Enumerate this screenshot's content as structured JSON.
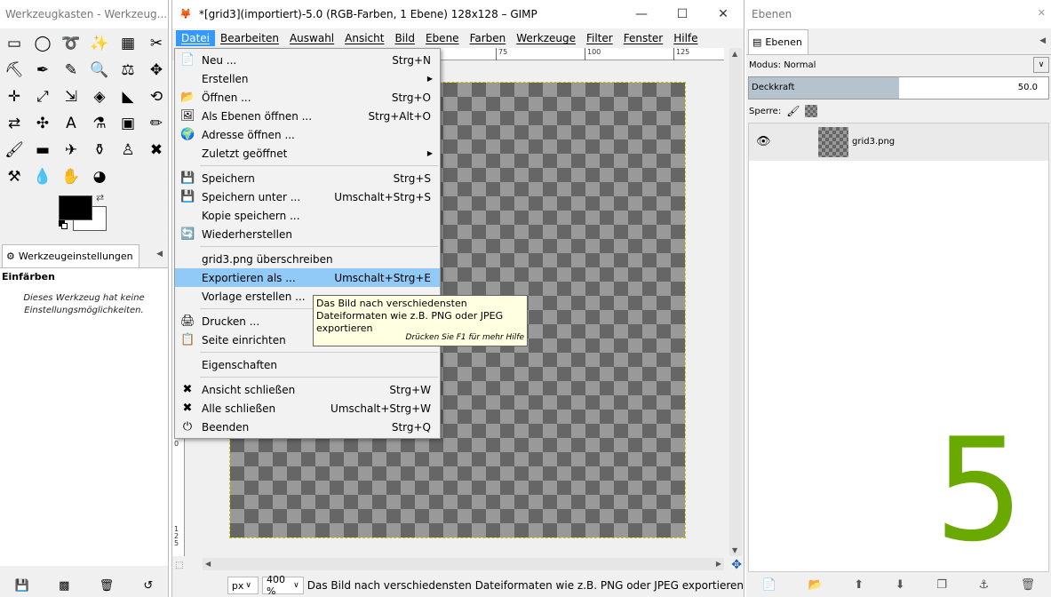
{
  "toolbox": {
    "title": "Werkzeugkasten - Werkzeug...",
    "tools": [
      "▭",
      "◯",
      "➰",
      "✨",
      "▦",
      "✂",
      "⛏",
      "✒",
      "✎",
      "🔍",
      "⚖",
      "✥",
      "✛",
      "⤢",
      "⇲",
      "◈",
      "◣",
      "⟲",
      "⇄",
      "✣",
      "A",
      "⚗",
      "▣",
      "✏",
      "🖌",
      "▬",
      "✈",
      "⚱",
      "♙",
      "✖",
      "⚒",
      "💧",
      "✋",
      "◕"
    ],
    "options_tab": "Werkzeugeinstellungen",
    "options_title": "Einfärben",
    "options_note": "Dieses Werkzeug hat keine Einstellungsmöglichkeiten.",
    "bottom_icons": [
      "💾",
      "▩",
      "🗑",
      "↺"
    ]
  },
  "image_window": {
    "title": "*[grid3](importiert)-5.0 (RGB-Farben, 1 Ebene) 128x128 – GIMP",
    "btn_minimize": "—",
    "btn_maximize": "☐",
    "btn_close": "✕",
    "menus": [
      "Datei",
      "Bearbeiten",
      "Auswahl",
      "Ansicht",
      "Bild",
      "Ebene",
      "Farben",
      "Werkzeuge",
      "Filter",
      "Fenster",
      "Hilfe"
    ],
    "ruler_top": [
      "75",
      "100",
      "125"
    ],
    "ruler_left": [
      "1",
      "0",
      "0",
      "1",
      "2",
      "5"
    ],
    "unit": "px",
    "zoom": "400 %",
    "status": "Das Bild nach verschiedensten Dateiformaten wie z.B. PNG oder JPEG exportieren"
  },
  "file_menu": {
    "items": [
      {
        "icon": "📄",
        "label": "Neu ...",
        "shortcut": "Strg+N",
        "u": "N"
      },
      {
        "icon": "",
        "label": "Erstellen",
        "shortcut": "",
        "sub": true,
        "u": "E"
      },
      {
        "icon": "📂",
        "label": "Öffnen ...",
        "shortcut": "Strg+O",
        "u": "Ö"
      },
      {
        "icon": "🖼",
        "label": "Als Ebenen öffnen ...",
        "shortcut": "Strg+Alt+O"
      },
      {
        "icon": "🌍",
        "label": "Adresse öffnen ...",
        "shortcut": ""
      },
      {
        "icon": "",
        "label": "Zuletzt geöffnet",
        "shortcut": "",
        "sub": true
      },
      {
        "icon": "💾",
        "label": "Speichern",
        "shortcut": "Strg+S"
      },
      {
        "icon": "💾",
        "label": "Speichern unter ...",
        "shortcut": "Umschalt+Strg+S"
      },
      {
        "icon": "",
        "label": "Kopie speichern ...",
        "shortcut": ""
      },
      {
        "icon": "🔄",
        "label": "Wiederherstellen",
        "shortcut": ""
      },
      {
        "icon": "",
        "label": "grid3.png überschreiben",
        "shortcut": ""
      },
      {
        "icon": "",
        "label": "Exportieren als ...",
        "shortcut": "Umschalt+Strg+E"
      },
      {
        "icon": "",
        "label": "Vorlage erstellen ...",
        "shortcut": ""
      },
      {
        "icon": "🖨",
        "label": "Drucken ...",
        "shortcut": ""
      },
      {
        "icon": "📋",
        "label": "Seite einrichten",
        "shortcut": ""
      },
      {
        "icon": "",
        "label": "Eigenschaften",
        "shortcut": ""
      },
      {
        "icon": "✖",
        "label": "Ansicht schließen",
        "shortcut": "Strg+W"
      },
      {
        "icon": "✖",
        "label": "Alle schließen",
        "shortcut": "Umschalt+Strg+W"
      },
      {
        "icon": "⏻",
        "label": "Beenden",
        "shortcut": "Strg+Q"
      }
    ]
  },
  "tooltip": {
    "text": "Das Bild nach verschiedensten Dateiformaten wie z.B. PNG oder JPEG exportieren",
    "hint": "Drücken Sie F1 für mehr Hilfe"
  },
  "layers": {
    "title": "Ebenen",
    "tab": "Ebenen",
    "mode": "Modus: Normal",
    "opacity_label": "Deckkraft",
    "opacity_value": "50.0",
    "opacity_fraction": 0.5,
    "lock_label": "Sperre:",
    "layer_name": "grid3.png",
    "overlay_number": "5",
    "bottom_icons": [
      "📄",
      "📂",
      "⬆",
      "⬇",
      "❐",
      "⚓",
      "🗑"
    ]
  },
  "colors": {
    "menu_highlight": "#91c9f7",
    "menubar_active": "#3399ff",
    "overlay_green": "#6aaa00"
  }
}
